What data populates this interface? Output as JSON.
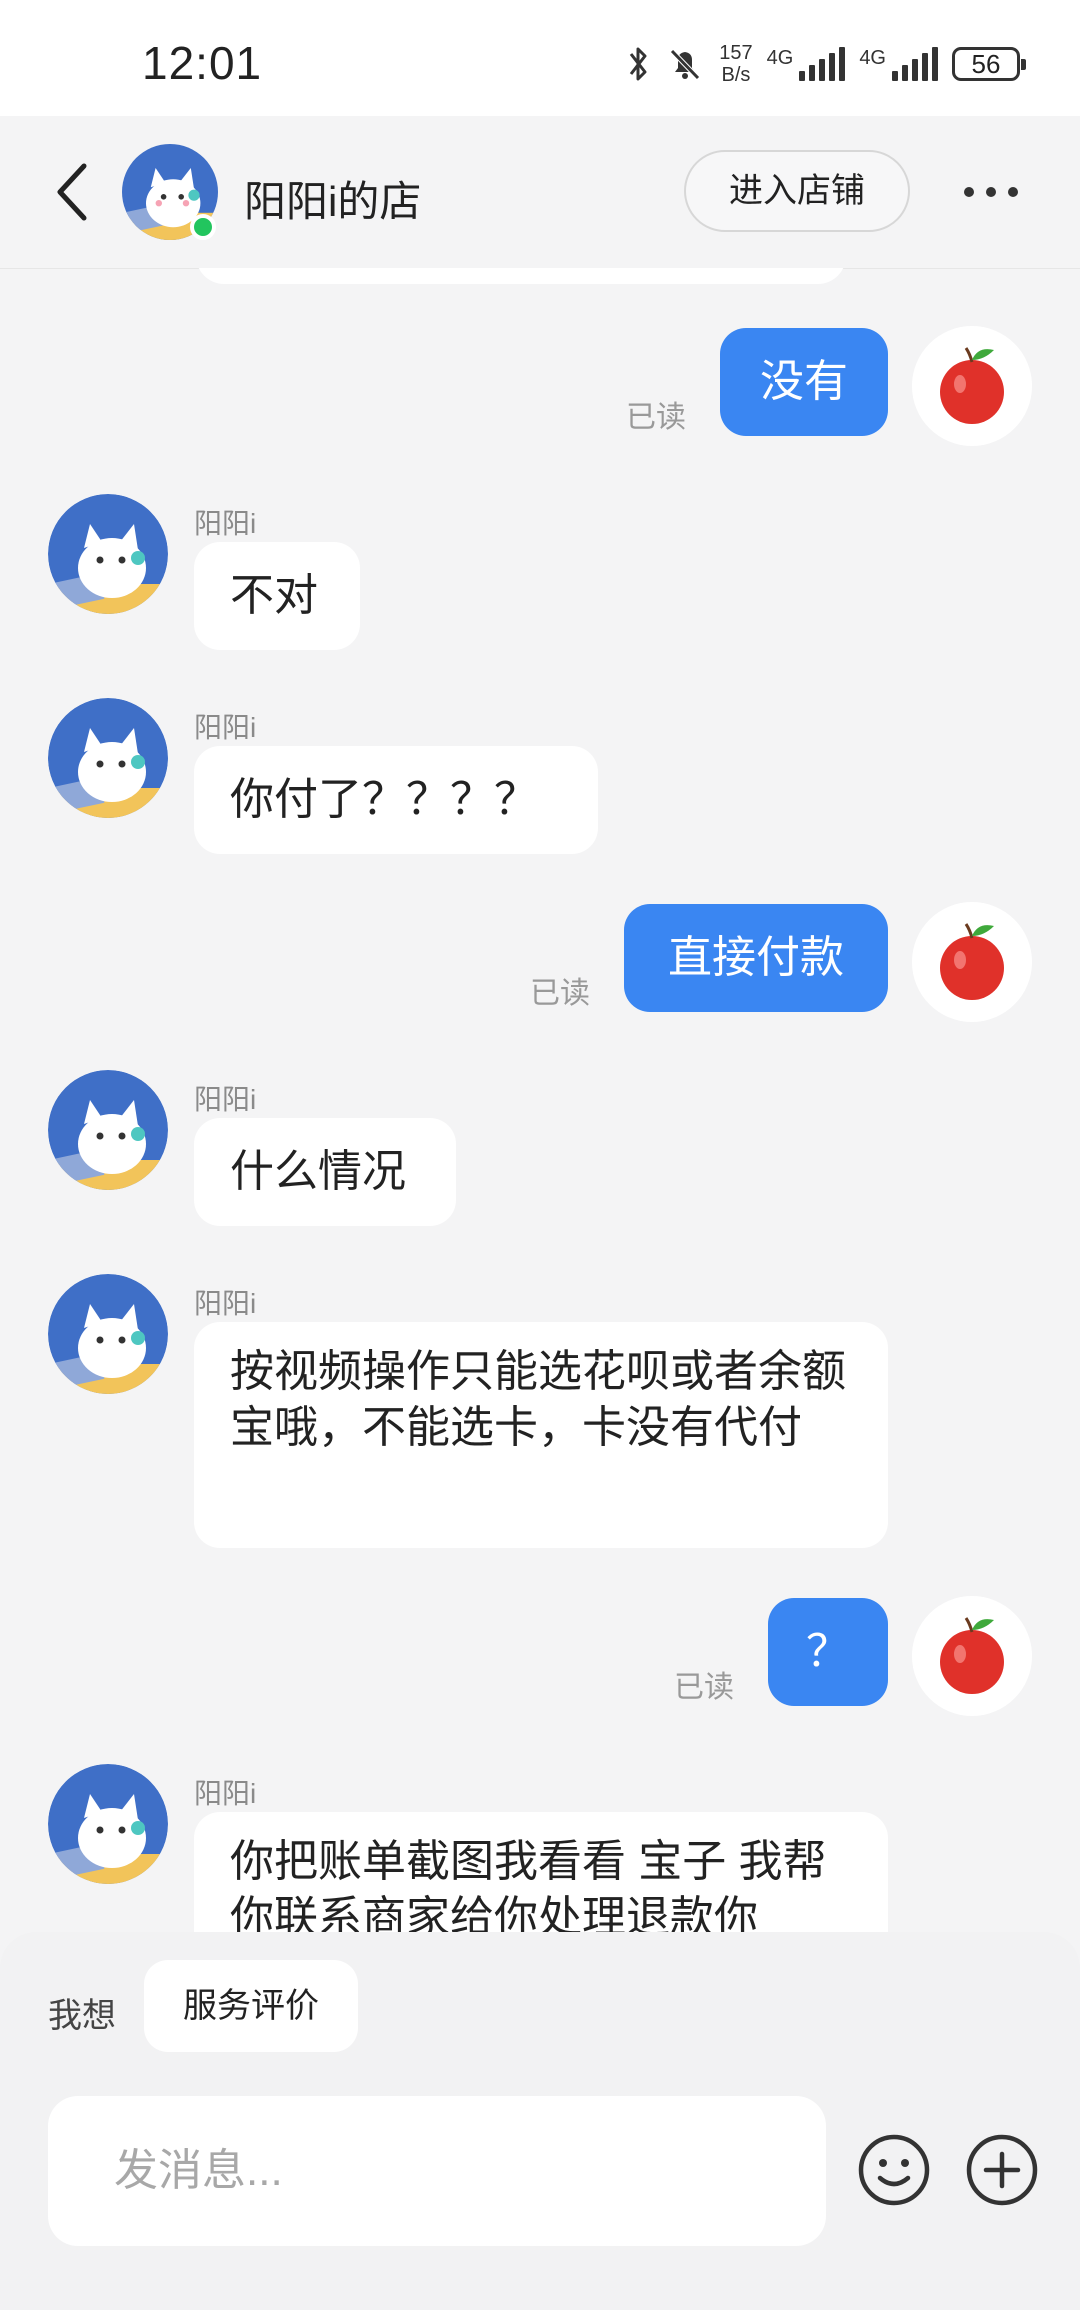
{
  "status_bar": {
    "time": "12:01",
    "net_speed_value": "157",
    "net_speed_unit": "B/s",
    "sim1": "4G",
    "sim2": "4G",
    "battery": "56"
  },
  "header": {
    "shop_name": "阳阳i的店",
    "enter_shop_label": "进入店铺",
    "online_color": "#22c55e"
  },
  "messages": [
    {
      "from": "me",
      "text": "没有",
      "status": "已读"
    },
    {
      "from": "shop",
      "sender": "阳阳i",
      "text": "不对"
    },
    {
      "from": "shop",
      "sender": "阳阳i",
      "text": "你付了？？？？"
    },
    {
      "from": "me",
      "text": "直接付款",
      "status": "已读"
    },
    {
      "from": "shop",
      "sender": "阳阳i",
      "text": "什么情况"
    },
    {
      "from": "shop",
      "sender": "阳阳i",
      "text": "按视频操作只能选花呗或者余额宝哦，不能选卡，卡没有代付"
    },
    {
      "from": "me",
      "text": "？",
      "status": "已读"
    },
    {
      "from": "shop",
      "sender": "阳阳i",
      "text": "你把账单截图我看看 宝子  我帮你联系商家给你处理退款你"
    }
  ],
  "bottom": {
    "want_label": "我想",
    "chip_label": "服务评价",
    "input_placeholder": "发消息..."
  },
  "colors": {
    "outgoing_bubble": "#3a86f2",
    "incoming_bubble": "#ffffff",
    "background": "#f4f4f5"
  },
  "icons": [
    "back-arrow-icon",
    "more-icon",
    "emoji-icon",
    "plus-icon",
    "apple-avatar-icon",
    "cat-avatar-icon"
  ]
}
